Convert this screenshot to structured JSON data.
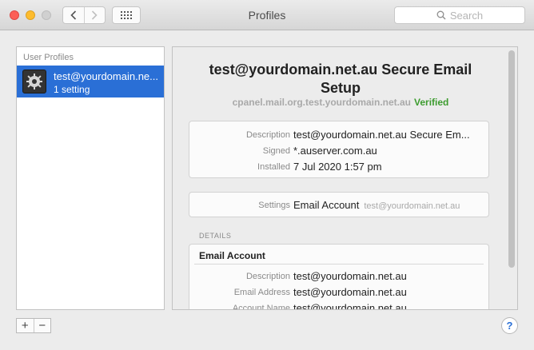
{
  "window": {
    "title": "Profiles"
  },
  "search": {
    "placeholder": "Search"
  },
  "sidebar": {
    "heading": "User Profiles",
    "items": [
      {
        "name": "test@yourdomain.ne...",
        "subtitle": "1 setting"
      }
    ]
  },
  "detail": {
    "title": "test@yourdomain.net.au Secure Email Setup",
    "hostname": "cpanel.mail.org.test.yourdomain.net.au",
    "status": "Verified",
    "summary": [
      {
        "label": "Description",
        "value": "test@yourdomain.net.au Secure Em..."
      },
      {
        "label": "Signed",
        "value": "*.auserver.com.au"
      },
      {
        "label": "Installed",
        "value": "7 Jul 2020 1:57 pm"
      }
    ],
    "settings": {
      "label": "Settings",
      "value": "Email Account",
      "detail": "test@yourdomain.net.au"
    },
    "details_heading": "DETAILS",
    "account": {
      "heading": "Email Account",
      "rows": [
        {
          "label": "Description",
          "value": "test@yourdomain.net.au"
        },
        {
          "label": "Email Address",
          "value": "test@yourdomain.net.au"
        },
        {
          "label": "Account Name",
          "value": "test@yourdomain.net.au"
        }
      ]
    }
  },
  "footer": {
    "add": "+",
    "remove": "−",
    "help": "?"
  },
  "colors": {
    "selection": "#2a6fd6",
    "verified": "#3d9c2f"
  }
}
